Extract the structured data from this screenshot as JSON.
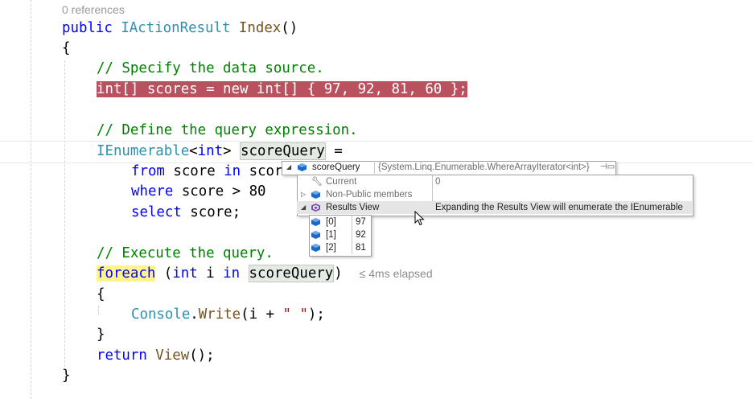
{
  "codelens": {
    "references": "0 references"
  },
  "code": {
    "l1_kw": "public",
    "l1_type": "IActionResult",
    "l1_method": "Index",
    "l1_paren": "()",
    "brace_open": "{",
    "comment_source": "// Specify the data source.",
    "breakpoint_line": "int[] scores = new int[] { 97, 92, 81, 60 };",
    "comment_query": "// Define the query expression.",
    "ienum_type": "IEnumerable",
    "ienum_generic_open": "<",
    "ienum_int": "int",
    "ienum_generic_close": ">",
    "score_query": "scoreQuery",
    "equals": " =",
    "from_kw": "from",
    "from_rest": " score ",
    "in_kw": "in",
    "from_tail": " scor",
    "where_kw": "where",
    "where_rest": " score > 80",
    "select_kw": "select",
    "select_rest": " score;",
    "comment_execute": "// Execute the query.",
    "foreach_kw": "foreach",
    "foreach_paren_open": " (",
    "foreach_int": "int",
    "foreach_i": " i ",
    "foreach_in": "in",
    "foreach_query": "scoreQuery",
    "foreach_paren_close": ")",
    "elapsed": "≤ 4ms elapsed",
    "inner_brace_open": "{",
    "console_type": "Console",
    "console_dot": ".",
    "console_method": "Write",
    "console_args_open": "(i + ",
    "console_string": "\" \"",
    "console_args_close": ");",
    "inner_brace_close": "}",
    "return_kw": "return",
    "return_method": " View",
    "return_rest": "();",
    "brace_close": "}"
  },
  "datatip": {
    "name": "scoreQuery",
    "value": "{System.Linq.Enumerable.WhereArrayIterator<int>}",
    "children": [
      {
        "name": "Current",
        "value": "0"
      },
      {
        "name": "Non-Public members",
        "value": ""
      },
      {
        "name": "Results View",
        "value": "Expanding the Results View will enumerate the IEnumerable"
      }
    ],
    "results": [
      {
        "index": "[0]",
        "value": "97"
      },
      {
        "index": "[1]",
        "value": "92"
      },
      {
        "index": "[2]",
        "value": "81"
      }
    ]
  },
  "colors": {
    "keyword": "#0000ff",
    "type": "#2b91af",
    "comment": "#008000",
    "breakpoint": "#b9515f",
    "string": "#a31515"
  }
}
